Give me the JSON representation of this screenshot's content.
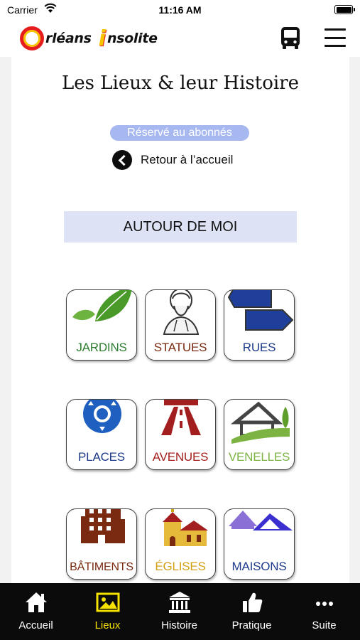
{
  "status_bar": {
    "carrier": "Carrier",
    "time": "11:16 AM"
  },
  "header": {
    "logo_word1": "rléans",
    "logo_word2": "nsolite",
    "bus_icon": "bus-icon",
    "menu_icon": "hamburger-menu-icon"
  },
  "page": {
    "title": "Les Lieux & leur Histoire",
    "badge": "Réservé au abonnés",
    "back_label": "Retour à l’accueil",
    "around_button": "AUTOUR DE MOI"
  },
  "tiles": [
    {
      "label": "JARDINS",
      "color": "#2e7d32",
      "icon": "leaves-icon"
    },
    {
      "label": "STATUES",
      "color": "#7b2a12",
      "icon": "statue-bust-icon"
    },
    {
      "label": "RUES",
      "color": "#1e3a8a",
      "icon": "street-sign-icon"
    },
    {
      "label": "PLACES",
      "color": "#1e3a8a",
      "icon": "roundabout-icon"
    },
    {
      "label": "AVENUES",
      "color": "#a31f1f",
      "icon": "road-icon"
    },
    {
      "label": "VENELLES",
      "color": "#7cb342",
      "icon": "house-lane-icon"
    },
    {
      "label": "BÂTIMENTS",
      "color": "#7b2a12",
      "icon": "building-icon"
    },
    {
      "label": "ÉGLISES",
      "color": "#d4a017",
      "icon": "church-icon"
    },
    {
      "label": "MAISONS",
      "color": "#1e3a8a",
      "icon": "houses-icon"
    }
  ],
  "tab_bar": {
    "items": [
      {
        "label": "Accueil",
        "icon": "home-icon",
        "active": false
      },
      {
        "label": "Lieux",
        "icon": "image-icon",
        "active": true
      },
      {
        "label": "Histoire",
        "icon": "museum-icon",
        "active": false
      },
      {
        "label": "Pratique",
        "icon": "thumbs-up-icon",
        "active": false
      },
      {
        "label": "Suite",
        "icon": "more-dots-icon",
        "active": false
      }
    ],
    "active_color": "#f5e200"
  }
}
